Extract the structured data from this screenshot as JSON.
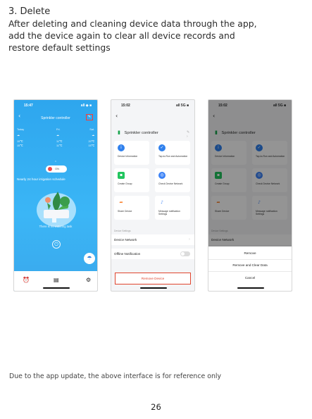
{
  "heading": {
    "title": "3. Delete",
    "lines": [
      "After deleting and cleaning device data through the app,",
      "add the device again to clear all device records and",
      "restore default settings"
    ]
  },
  "screen1": {
    "time": "15:47",
    "status": "all ◈ ■",
    "title": "Sprinkler controller",
    "weather_rows": [
      [
        "Today",
        "Fri.",
        "Sat."
      ],
      [
        "15℃",
        "11℃",
        "20℃"
      ],
      [
        "15℃",
        "11℃",
        "15℃"
      ]
    ],
    "toggle_label": "ON",
    "schedule": "Nearly 24 hour irrigation schedule",
    "no_watering": "There is no watering task",
    "accent": "#3aaef2"
  },
  "screen2": {
    "time": "15:02",
    "status": "all 5G ■",
    "device_name": "Sprinkler controller",
    "tiles": [
      {
        "label": "Device Information",
        "icon": "info-icon",
        "color": "#2f80ed"
      },
      {
        "label": "Tap-to-Run and Automation",
        "icon": "check-icon",
        "color": "#2f80ed"
      },
      {
        "label": "Create Group",
        "icon": "group-icon",
        "color": "#22c55e"
      },
      {
        "label": "Check Device Network",
        "icon": "network-icon",
        "color": "#3b82f6"
      },
      {
        "label": "Share Device",
        "icon": "share-icon",
        "color": "#f97316"
      },
      {
        "label": "Message notification Settings",
        "icon": "bell-icon",
        "color": "#3b82f6"
      }
    ],
    "section_label": "Device Settings",
    "rows": [
      {
        "label": "Device Network"
      },
      {
        "label": "Offline Notification"
      }
    ],
    "remove_label": "Remove Device"
  },
  "screen3": {
    "time": "15:02",
    "status": "all 5G ■",
    "sheet_options": [
      "Remove",
      "Remove and Clear Data",
      "Cancel"
    ]
  },
  "footer_note": "Due to the app update, the above interface is for reference only",
  "page_number": "26"
}
